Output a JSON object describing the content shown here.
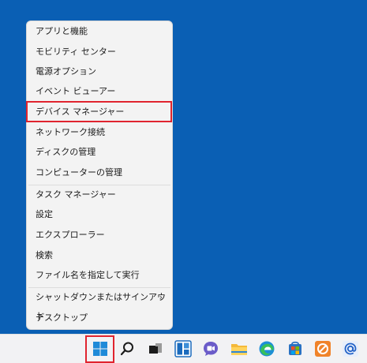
{
  "menu": {
    "items": [
      {
        "label": "アプリと機能"
      },
      {
        "label": "モビリティ センター"
      },
      {
        "label": "電源オプション"
      },
      {
        "label": "イベント ビューアー"
      },
      {
        "label": "デバイス マネージャー"
      },
      {
        "label": "ネットワーク接続"
      },
      {
        "label": "ディスクの管理"
      },
      {
        "label": "コンピューターの管理"
      },
      {
        "label": "タスク マネージャー"
      },
      {
        "label": "設定"
      },
      {
        "label": "エクスプローラー"
      },
      {
        "label": "検索"
      },
      {
        "label": "ファイル名を指定して実行"
      },
      {
        "label": "シャットダウンまたはサインアウト"
      },
      {
        "label": "デスクトップ"
      }
    ],
    "submenu_arrow": "›",
    "highlighted_item": "デバイス マネージャー"
  },
  "taskbar": {
    "icons": [
      "windows-start-icon",
      "search-icon",
      "task-view-icon",
      "widgets-icon",
      "teams-chat-icon",
      "file-explorer-icon",
      "edge-icon",
      "store-icon",
      "app-icon",
      "mail-icon"
    ]
  },
  "colors": {
    "desktop": "#0a5fb4",
    "highlight": "#e0242f"
  }
}
